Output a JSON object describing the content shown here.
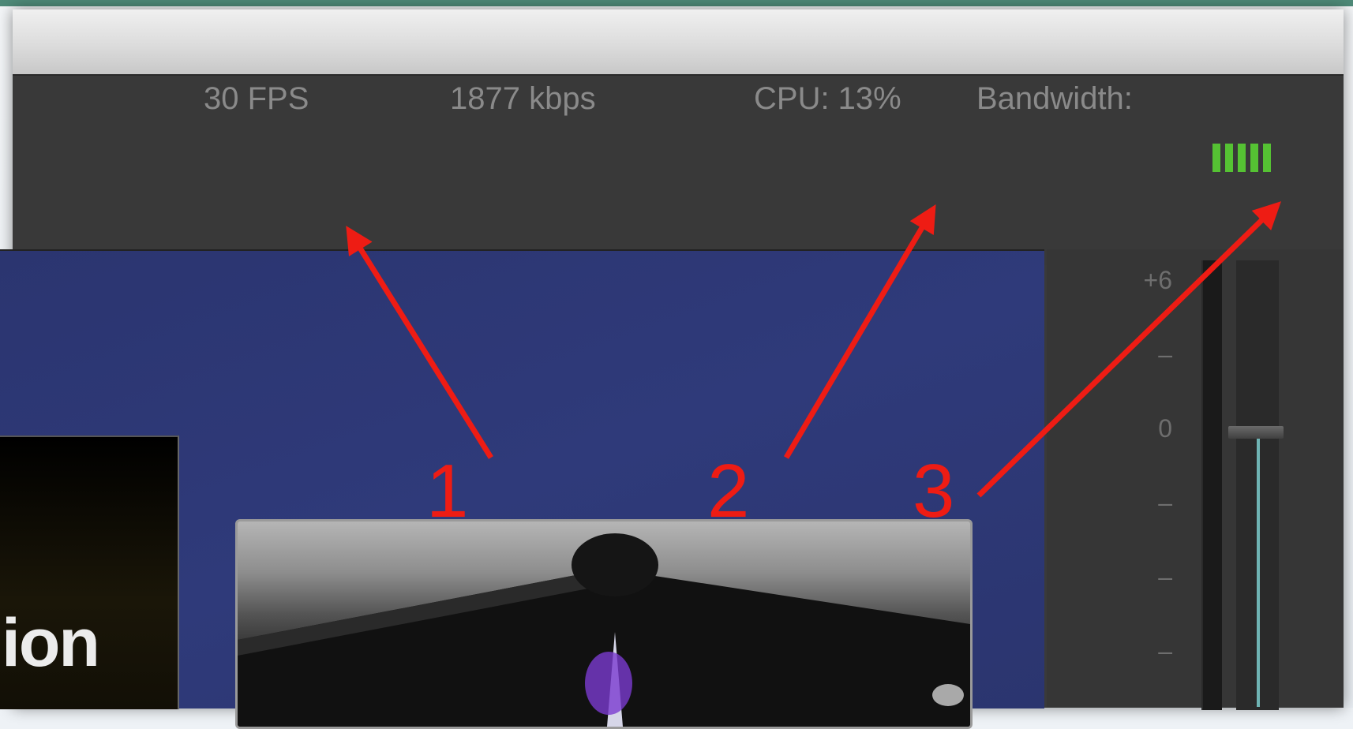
{
  "stats": {
    "fps": "30 FPS",
    "bitrate": "1877 kbps",
    "cpu": "CPU:  13%",
    "bandwidth_label": "Bandwidth:",
    "bandwidth_level": 1.0
  },
  "slide": {
    "text": "ion"
  },
  "audio_meter": {
    "ticks": [
      "+6",
      "–",
      "0",
      "–",
      "–",
      "–"
    ]
  },
  "annotations": {
    "one": "1",
    "two": "2",
    "three": "3"
  },
  "colors": {
    "annotation": "#ee1c14",
    "bandwidth_good": "#55c233",
    "preview_bg": "#2f3a7a"
  }
}
